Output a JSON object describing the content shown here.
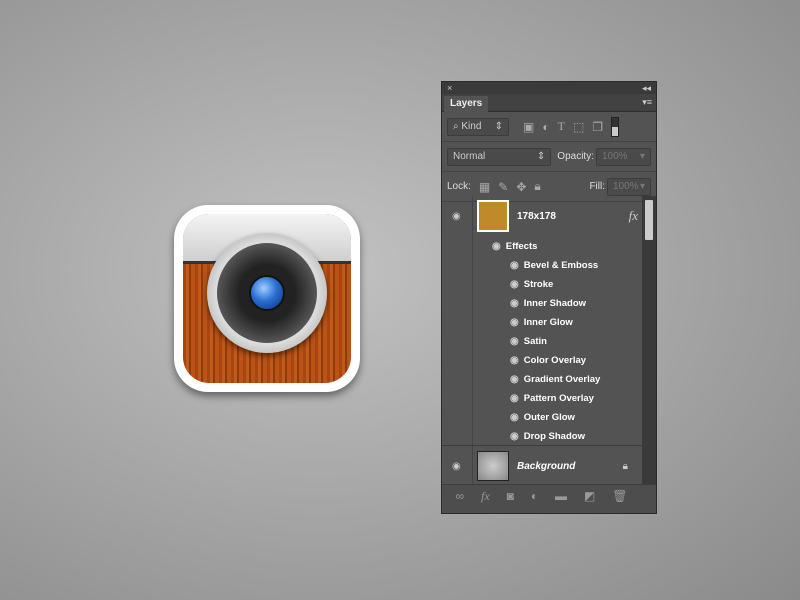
{
  "panel": {
    "close": "×",
    "collapse": "◂◂",
    "tab": "Layers",
    "menu": "▾≡",
    "filter": {
      "kind": "Kind"
    },
    "blend_mode": "Normal",
    "opacity_label": "Opacity:",
    "opacity_value": "100%",
    "lock_label": "Lock:",
    "fill_label": "Fill:",
    "fill_value": "100%",
    "layers": [
      {
        "name": "178x178",
        "fx": "fx",
        "effects_label": "Effects",
        "effects": [
          "Bevel & Emboss",
          "Stroke",
          "Inner Shadow",
          "Inner Glow",
          "Satin",
          "Color Overlay",
          "Gradient Overlay",
          "Pattern Overlay",
          "Outer Glow",
          "Drop Shadow"
        ]
      },
      {
        "name": "Background",
        "locked": true
      }
    ]
  },
  "colors": {
    "panel": "#535353",
    "thumb": "#c08a2a"
  }
}
